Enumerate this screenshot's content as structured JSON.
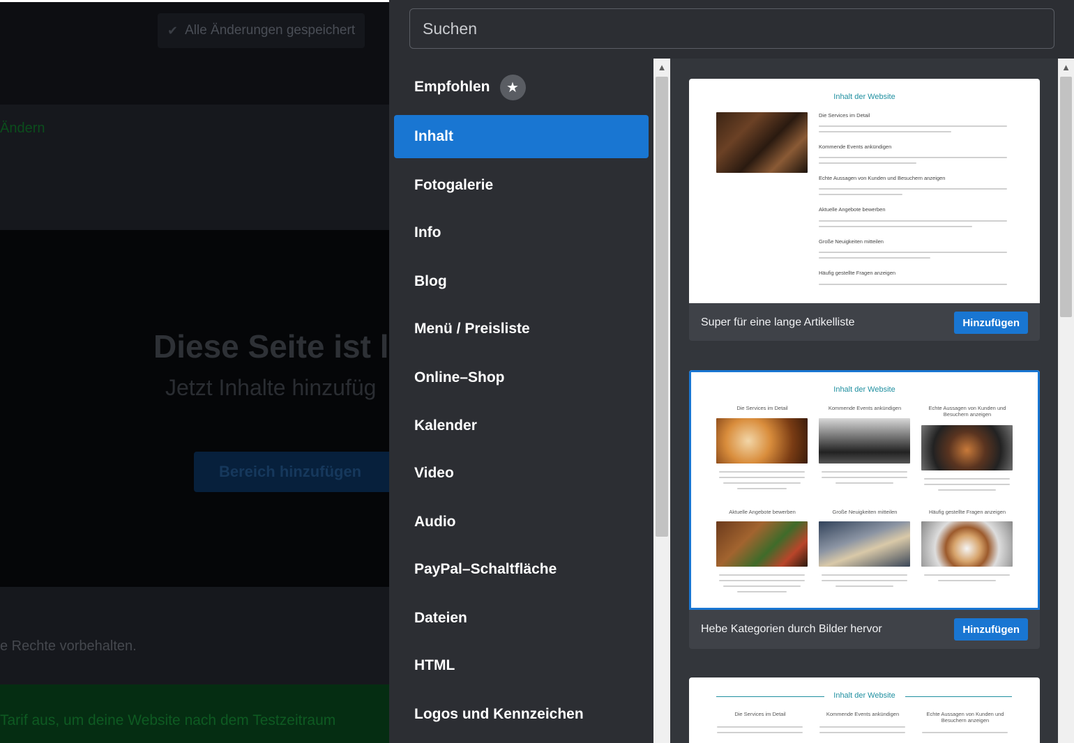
{
  "background": {
    "save_status": "Alle Änderungen gespeichert",
    "change_link": "Ändern",
    "hero_title": "Diese Seite ist le",
    "hero_subtitle": "Jetzt Inhalte hinzufüg",
    "hero_button": "Bereich hinzufügen",
    "footer_rights": "e Rechte vorbehalten.",
    "trial_banner": "Tarif aus, um deine Website nach dem Testzeitraum"
  },
  "search": {
    "placeholder": "Suchen"
  },
  "categories": [
    {
      "label": "Empfohlen",
      "icon": "star-icon"
    },
    {
      "label": "Inhalt",
      "active": true
    },
    {
      "label": "Fotogalerie"
    },
    {
      "label": "Info"
    },
    {
      "label": "Blog"
    },
    {
      "label": "Menü / Preisliste"
    },
    {
      "label": "Online–Shop"
    },
    {
      "label": "Kalender"
    },
    {
      "label": "Video"
    },
    {
      "label": "Audio"
    },
    {
      "label": "PayPal–Schaltfläche"
    },
    {
      "label": "Dateien"
    },
    {
      "label": "HTML"
    },
    {
      "label": "Logos und Kennzeichen"
    }
  ],
  "templates": [
    {
      "description": "Super für eine lange Artikelliste",
      "button": "Hinzufügen",
      "preview": {
        "title": "Inhalt der Website",
        "items": [
          "Die Services im Detail",
          "Kommende Events ankündigen",
          "Echte Aussagen von Kunden und Besuchern anzeigen",
          "Aktuelle Angebote bewerben",
          "Große Neuigkeiten mitteilen",
          "Häufig gestellte Fragen anzeigen"
        ]
      }
    },
    {
      "description": "Hebe Kategorien durch Bilder hervor",
      "button": "Hinzufügen",
      "selected": true,
      "preview": {
        "title": "Inhalt der Website",
        "items": [
          "Die Services im Detail",
          "Kommende Events ankündigen",
          "Echte Aussagen von Kunden und Besuchern anzeigen",
          "Aktuelle Angebote bewerben",
          "Große Neuigkeiten mitteilen",
          "Häufig gestellte Fragen anzeigen"
        ]
      }
    },
    {
      "preview": {
        "title": "Inhalt der Website",
        "items": [
          "Die Services im Detail",
          "Kommende Events ankündigen",
          "Echte Aussagen von Kunden und Besuchern anzeigen"
        ]
      }
    }
  ],
  "colors": {
    "accent": "#1976d2",
    "panel": "#2c2e33",
    "preview_title": "#1f8fa0"
  }
}
